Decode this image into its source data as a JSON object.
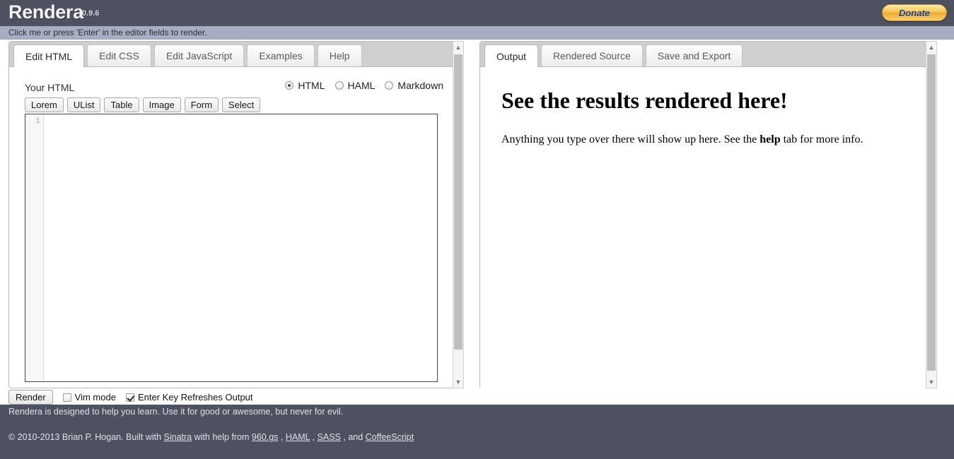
{
  "header": {
    "title": "Rendera",
    "version": "0.9.6",
    "donate_label": "Donate"
  },
  "notice": {
    "text": "Click me or press 'Enter' in the editor fields to render."
  },
  "editor_panel": {
    "tabs": [
      {
        "label": "Edit HTML",
        "active": true
      },
      {
        "label": "Edit CSS",
        "active": false
      },
      {
        "label": "Edit JavaScript",
        "active": false
      },
      {
        "label": "Examples",
        "active": false
      },
      {
        "label": "Help",
        "active": false
      }
    ],
    "field_label": "Your HTML",
    "format_options": [
      {
        "label": "HTML",
        "selected": true
      },
      {
        "label": "HAML",
        "selected": false
      },
      {
        "label": "Markdown",
        "selected": false
      }
    ],
    "snippet_buttons": [
      "Lorem",
      "UList",
      "Table",
      "Image",
      "Form",
      "Select"
    ],
    "code_value": "",
    "line_numbers": [
      "1"
    ]
  },
  "output_panel": {
    "tabs": [
      {
        "label": "Output",
        "active": true
      },
      {
        "label": "Rendered Source",
        "active": false
      },
      {
        "label": "Save and Export",
        "active": false
      }
    ],
    "heading": "See the results rendered here!",
    "paragraph_before": "Anything you type over there will show up here. See the ",
    "paragraph_bold": "help",
    "paragraph_after": " tab for more info."
  },
  "bottom_controls": {
    "render_label": "Render",
    "vim_mode_label": "Vim mode",
    "vim_mode_checked": false,
    "enter_key_label": "Enter Key Refreshes Output",
    "enter_key_checked": true
  },
  "footer": {
    "tagline": "Rendera is designed to help you learn. Use it for good or awesome, but never for evil.",
    "credit_prefix": "© 2010-2013 Brian P. Hogan. Built with ",
    "link_sinatra": "Sinatra",
    "credit_mid": " with help from ",
    "link_960gs": "960.gs",
    "sep1": " , ",
    "link_haml": "HAML",
    "sep2": " , ",
    "link_sass": "SASS",
    "sep3": " , and ",
    "link_coffeescript": "CoffeeScript"
  },
  "scrollbars": {
    "up_arrow": "▲",
    "down_arrow": "▼"
  },
  "colors": {
    "header_bg": "#4e5260",
    "notice_bg": "#a8aec2",
    "donate_accent": "#f0a92e",
    "donate_text": "#1b3a7a"
  }
}
